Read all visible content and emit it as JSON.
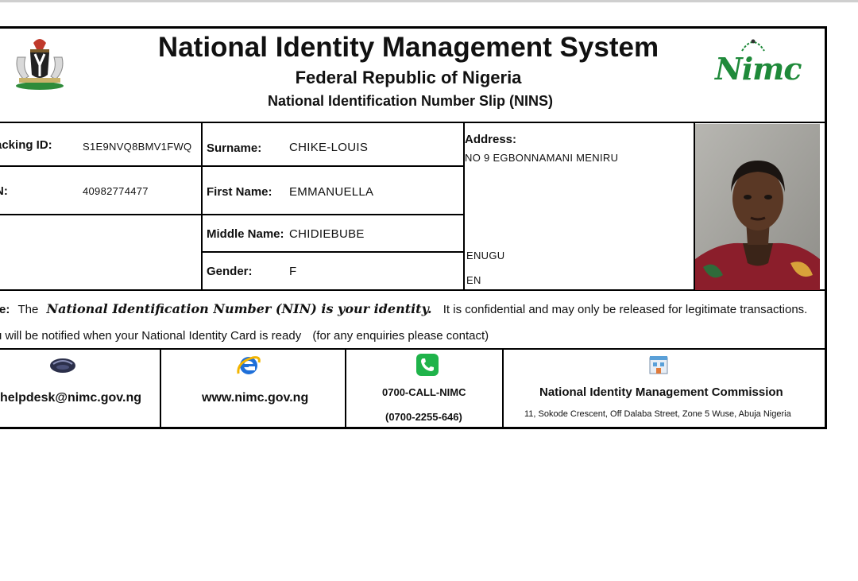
{
  "header": {
    "title": "National Identity Management System",
    "subtitle": "Federal Republic of Nigeria",
    "slip_title": "National Identification Number Slip (NINS)",
    "logo_text": "Nimc"
  },
  "fields": {
    "tracking_label": "acking ID:",
    "tracking_value": "S1E9NVQ8BMV1FWQ",
    "nin_label": "N:",
    "nin_value": "40982774477",
    "surname_label": "Surname:",
    "surname_value": "CHIKE-LOUIS",
    "firstname_label": "First Name:",
    "firstname_value": "EMMANUELLA",
    "middlename_label": "Middle Name:",
    "middlename_value": "CHIDIEBUBE",
    "gender_label": "Gender:",
    "gender_value": "F",
    "address_label": "Address:",
    "address_line1": "NO 9 EGBONNAMANI MENIRU",
    "address_city": "ENUGU",
    "address_state": "EN"
  },
  "note": {
    "label": "te:",
    "the": "The",
    "emphasis": "National Identification Number (NIN) is your identity.",
    "rest": "It is confidential and may only be released for legitimate transactions.",
    "line2a": "u will be notified when your National Identity Card is ready",
    "line2b": "(for any enquiries please contact)"
  },
  "footer": {
    "email": "helpdesk@nimc.gov.ng",
    "website": "www.nimc.gov.ng",
    "phone1": "0700-CALL-NIMC",
    "phone2": "(0700-2255-646)",
    "org_name": "National Identity Management Commission",
    "org_address": "11, Sokode Crescent, Off Dalaba Street, Zone 5 Wuse, Abuja Nigeria"
  },
  "colors": {
    "nimc_green": "#1f8a3a",
    "phone_green": "#1fb34a",
    "ie_blue": "#1e6fd9"
  }
}
